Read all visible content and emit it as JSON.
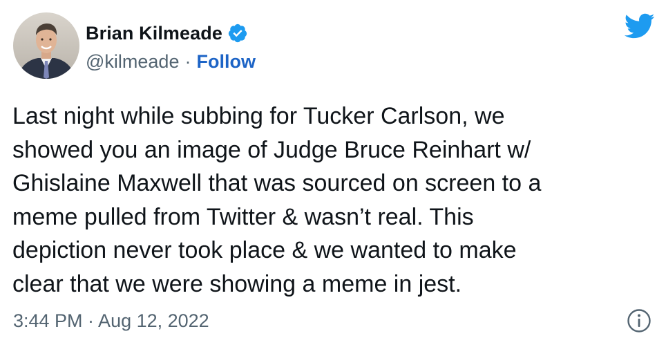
{
  "user": {
    "display_name": "Brian Kilmeade",
    "handle": "@kilmeade",
    "separator": "·",
    "follow_label": "Follow",
    "verified_icon": "verified-badge-icon"
  },
  "tweet": {
    "text": "Last night while subbing for Tucker Carlson, we\nshowed you an image of Judge Bruce Reinhart w/\nGhislaine Maxwell that was sourced on screen to a\nmeme pulled from Twitter & wasn’t real. This\ndepiction never took place & we wanted to make\nclear that we were showing a meme in jest.",
    "timestamp": "3:44 PM · Aug 12, 2022"
  },
  "icons": {
    "brand": "twitter-bird-icon",
    "info": "info-icon"
  },
  "colors": {
    "twitter_blue": "#1d9bf0",
    "follow_link": "#1d64c6",
    "secondary_text": "#536471",
    "primary_text": "#0f1419"
  }
}
